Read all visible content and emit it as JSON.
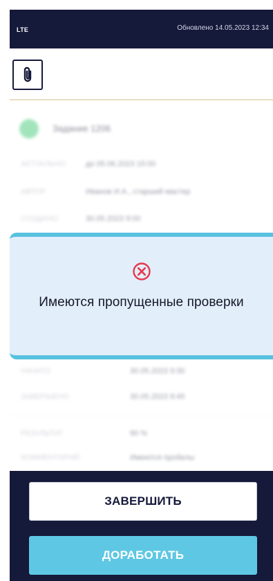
{
  "status_bar": {
    "network": "LTE",
    "updated": "Обновлено 14.05.2023 12:34"
  },
  "toolbar": {
    "attach_icon": "paperclip-icon"
  },
  "task": {
    "title": "Задание 1206",
    "status_color": "#56cf86",
    "fields": [
      {
        "label": "АКТУАЛЬНО",
        "value": "до 05.06.2023 15:00"
      },
      {
        "label": "АВТОР",
        "value": "Иванов И.А., старший мастер"
      },
      {
        "label": "СОЗДАНО",
        "value": "30.05.2023 9:00"
      }
    ],
    "fields_lower": [
      {
        "label": "НАЧАТО",
        "value": "30.05.2023 9:30"
      },
      {
        "label": "ЗАВЕРШЕНО",
        "value": "30.05.2023 9:45"
      }
    ],
    "extra": [
      {
        "label": "РЕЗУЛЬТАТ",
        "value": "90 %"
      },
      {
        "label": "КОММЕНТАРИЙ",
        "value": "Имеются пробелы"
      }
    ]
  },
  "modal": {
    "icon": "error-x-circle-icon",
    "message": "Имеются пропущенные проверки",
    "accent_color": "#58c1df"
  },
  "actions": {
    "finish_label": "ЗАВЕРШИТЬ",
    "rework_label": "ДОРАБОТАТЬ"
  }
}
